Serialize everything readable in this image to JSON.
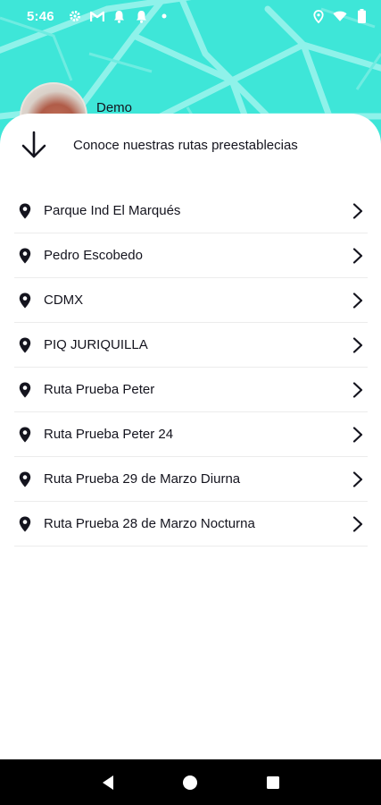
{
  "status_bar": {
    "time": "5:46"
  },
  "profile": {
    "name": "Demo"
  },
  "sheet": {
    "title": "Conoce nuestras rutas preestablecias"
  },
  "routes": [
    {
      "label": "Parque Ind El Marqués"
    },
    {
      "label": "Pedro Escobedo"
    },
    {
      "label": "CDMX"
    },
    {
      "label": "PIQ JURIQUILLA"
    },
    {
      "label": "Ruta Prueba Peter"
    },
    {
      "label": "Ruta Prueba Peter 24"
    },
    {
      "label": "Ruta Prueba 29 de Marzo Diurna"
    },
    {
      "label": "Ruta Prueba 28 de Marzo Nocturna"
    }
  ],
  "icons": {
    "status_left": [
      "settings-icon",
      "gmail-icon",
      "notification-icon",
      "notification-icon",
      "dot-icon"
    ],
    "status_right": [
      "location-icon",
      "wifi-icon",
      "battery-icon"
    ],
    "route_marker": "map-pin-icon",
    "route_action": "chevron-right-icon",
    "sheet_toggle": "arrow-down-icon",
    "nav": [
      "back-icon",
      "home-icon",
      "recents-icon"
    ]
  },
  "colors": {
    "map_background": "#3ee6d8",
    "text": "#14141e",
    "nav_bar": "#000000"
  }
}
